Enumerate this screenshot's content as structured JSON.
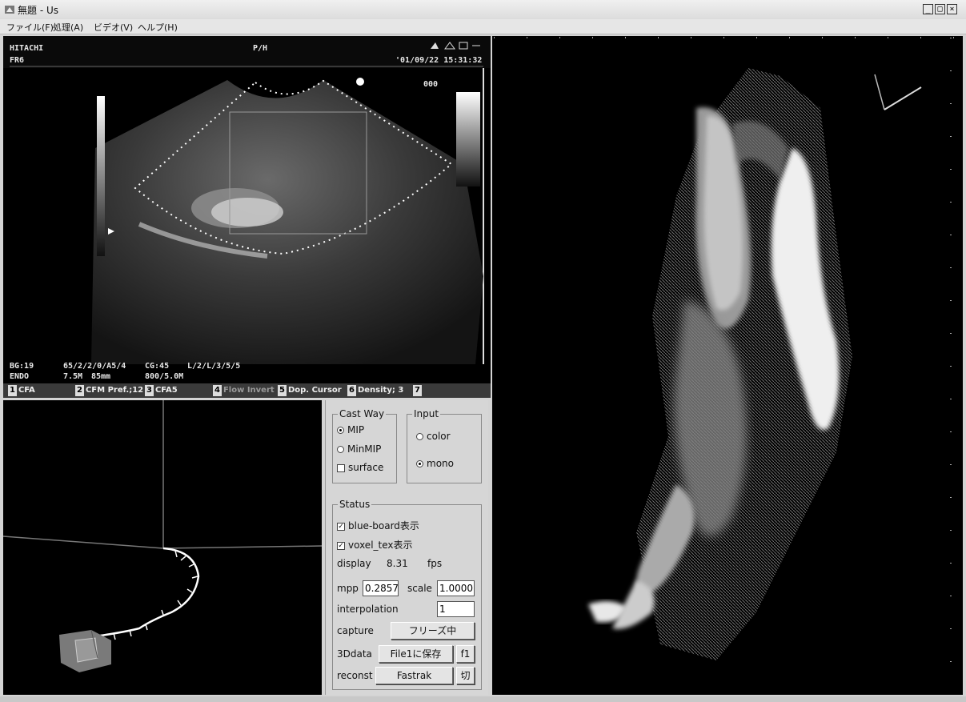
{
  "window": {
    "title": "無題 - Us",
    "minimize": "_",
    "maximize": "□",
    "close": "×"
  },
  "menu": [
    {
      "label": "ファイル(F)"
    },
    {
      "label": "処理(A)"
    },
    {
      "label": "ビデオ(V)"
    },
    {
      "label": "ヘルプ(H)"
    }
  ],
  "ultrasound": {
    "brand": "HITACHI",
    "frame": "FR6",
    "center_label": "P/H",
    "datetime": "'01/09/22   15:31:32",
    "depth_mark": "000",
    "readouts": {
      "bg": "BG:19",
      "params1": "65/2/2/0/A5/4",
      "cg": "CG:45",
      "params2": "L/2/L/3/5/5",
      "mode": "ENDO",
      "freq": "7.5M",
      "depth": "85mm",
      "params3": "800/5.0M"
    },
    "soft_keys": [
      {
        "num": "1",
        "label": "CFA"
      },
      {
        "num": "2",
        "label": "CFM Pref.;12"
      },
      {
        "num": "3",
        "label": "CFA5"
      },
      {
        "num": "4",
        "label": "Flow Invert"
      },
      {
        "num": "5",
        "label": "Dop. Cursor"
      },
      {
        "num": "6",
        "label": "Density; 3"
      },
      {
        "num": "7",
        "label": ""
      }
    ]
  },
  "controls": {
    "cast_way": {
      "title": "Cast Way",
      "mip": "MIP",
      "minmip": "MinMIP",
      "surface": "surface",
      "selected": "MIP"
    },
    "input": {
      "title": "Input",
      "color": "color",
      "mono": "mono",
      "selected": "mono"
    },
    "status": {
      "title": "Status",
      "blue_board": "blue-board表示",
      "voxel_tex": "voxel_tex表示",
      "display_label": "display",
      "display_value": "8.31",
      "display_unit": "fps",
      "mpp_label": "mpp",
      "mpp_value": "0.2857",
      "scale_label": "scale",
      "scale_value": "1.0000",
      "interp_label": "interpolation",
      "interp_value": "1",
      "capture_label": "capture",
      "capture_button": "フリーズ中",
      "data3d_label": "3Ddata",
      "save_button": "File1に保存",
      "f1_button": "f1",
      "reconst_label": "reconst",
      "fastrak_button": "Fastrak",
      "cut_button": "切"
    }
  }
}
